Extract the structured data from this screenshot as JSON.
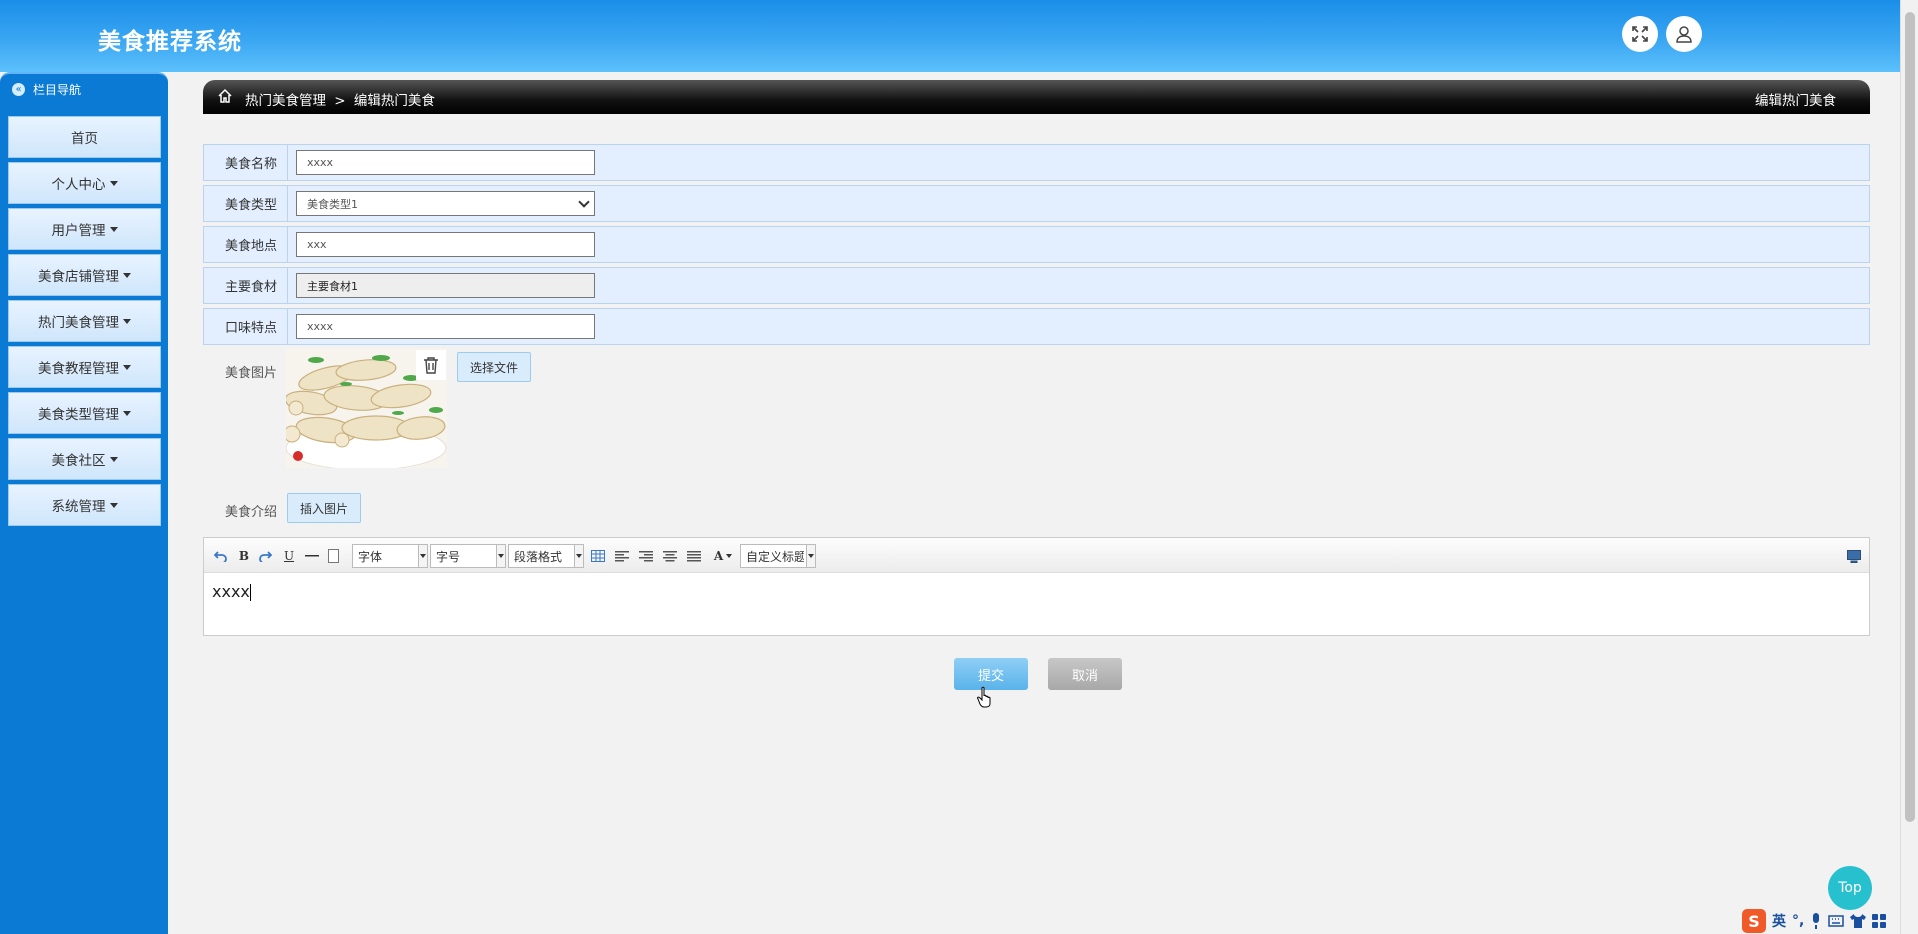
{
  "header": {
    "title": "美食推荐系统"
  },
  "sidebar": {
    "heading": "栏目导航",
    "items": [
      {
        "label": "首页",
        "dropdown": false
      },
      {
        "label": "个人中心",
        "dropdown": true
      },
      {
        "label": "用户管理",
        "dropdown": true
      },
      {
        "label": "美食店铺管理",
        "dropdown": true
      },
      {
        "label": "热门美食管理",
        "dropdown": true
      },
      {
        "label": "美食教程管理",
        "dropdown": true
      },
      {
        "label": "美食类型管理",
        "dropdown": true
      },
      {
        "label": "美食社区",
        "dropdown": true
      },
      {
        "label": "系统管理",
        "dropdown": true
      }
    ]
  },
  "breadcrumb": {
    "section": "热门美食管理",
    "separator": ">",
    "page": "编辑热门美食",
    "right_title": "编辑热门美食"
  },
  "form": {
    "name": {
      "label": "美食名称",
      "value": "xxxx"
    },
    "type": {
      "label": "美食类型",
      "value": "美食类型1"
    },
    "location": {
      "label": "美食地点",
      "value": "xxx"
    },
    "ingredient": {
      "label": "主要食材",
      "value": "主要食材1"
    },
    "taste": {
      "label": "口味特点",
      "value": "xxxx"
    },
    "image": {
      "label": "美食图片",
      "choose_label": "选择文件"
    },
    "intro": {
      "label": "美食介绍",
      "insert_label": "插入图片"
    }
  },
  "editor": {
    "font_label": "字体",
    "size_label": "字号",
    "paragraph_label": "段落格式",
    "custom_title_label": "自定义标题",
    "content": "xxxx"
  },
  "actions": {
    "submit": "提交",
    "cancel": "取消"
  },
  "top_button": "Top",
  "ime": {
    "lang": "英"
  }
}
